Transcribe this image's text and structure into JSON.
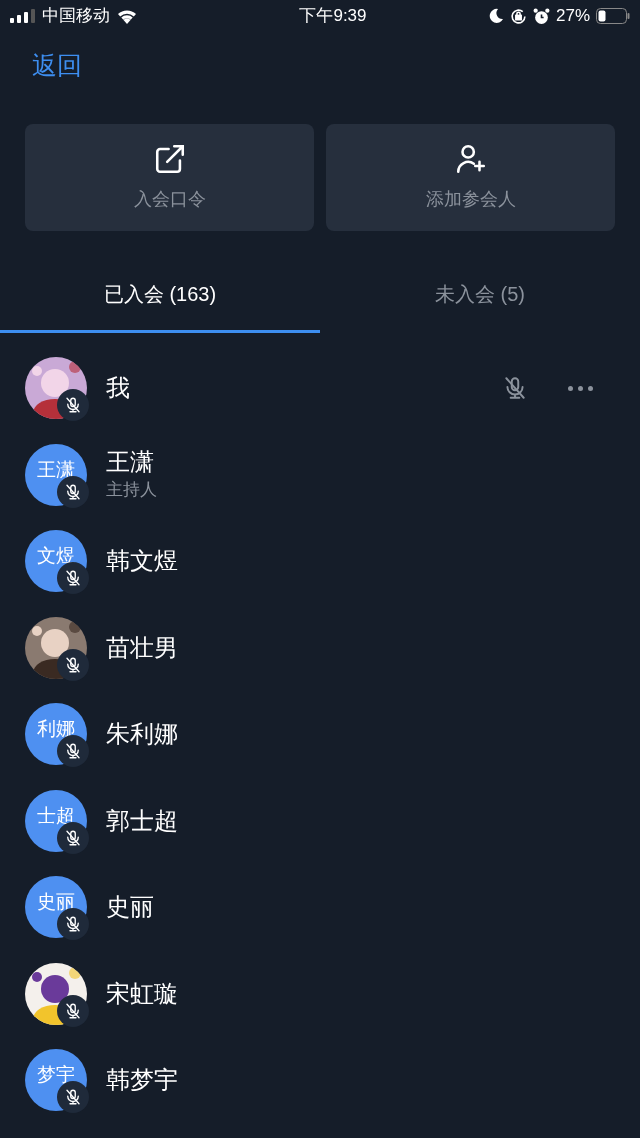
{
  "status_bar": {
    "carrier": "中国移动",
    "time": "下午9:39",
    "battery": "27%"
  },
  "back": "返回",
  "actions": [
    {
      "kind": "link",
      "label": "入会口令"
    },
    {
      "kind": "add-person",
      "label": "添加参会人"
    }
  ],
  "tabs": [
    {
      "label": "已入会 (163)",
      "selected": true
    },
    {
      "label": "未入会 (5)",
      "selected": false
    }
  ],
  "participants": [
    {
      "name": "我",
      "muted": true,
      "self": true
    },
    {
      "name": "王潇",
      "role": "主持人",
      "avatar": {
        "kind": "initials",
        "text": "王潇"
      },
      "muted": true
    },
    {
      "name": "韩文煜",
      "avatar": {
        "kind": "initials",
        "text": "文煜"
      },
      "muted": true
    },
    {
      "name": "苗壮男",
      "muted": true
    },
    {
      "name": "朱利娜",
      "avatar": {
        "kind": "initials",
        "text": "利娜"
      },
      "muted": true
    },
    {
      "name": "郭士超",
      "avatar": {
        "kind": "initials",
        "text": "士超"
      },
      "muted": true
    },
    {
      "name": "史丽",
      "avatar": {
        "kind": "initials",
        "text": "史丽"
      },
      "muted": true
    },
    {
      "name": "宋虹璇",
      "muted": true
    },
    {
      "name": "韩梦宇",
      "avatar": {
        "kind": "initials",
        "text": "梦宇"
      },
      "muted": true
    }
  ]
}
